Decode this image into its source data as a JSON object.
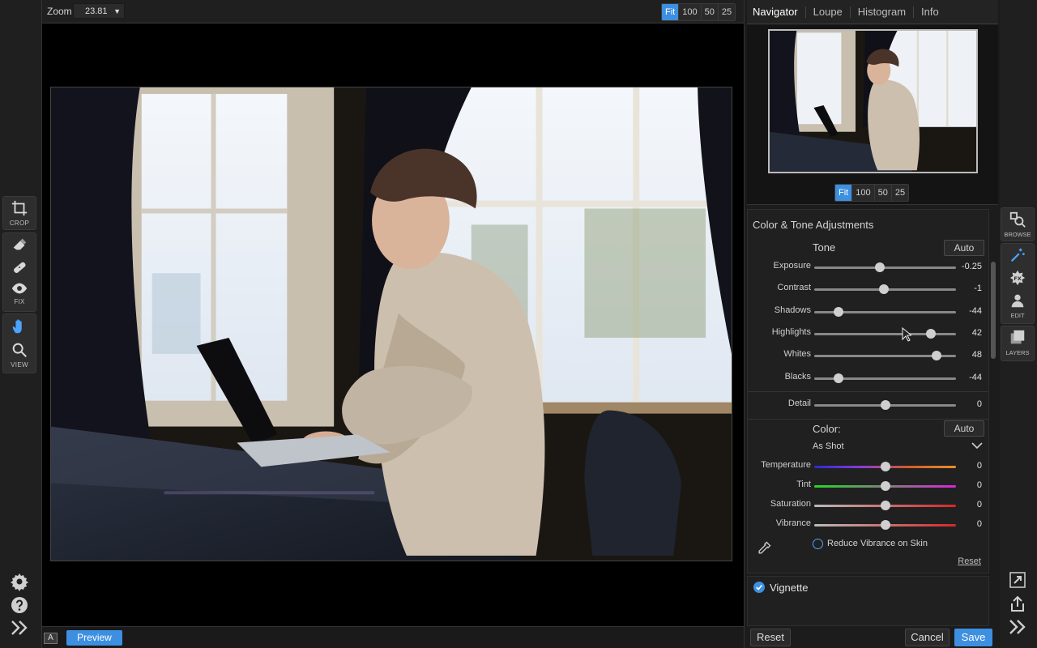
{
  "zoom": {
    "label": "Zoom",
    "value": "23.81",
    "presets": [
      "Fit",
      "100",
      "50",
      "25"
    ],
    "active": "Fit"
  },
  "left_tools": {
    "crop_label": "CROP",
    "fix_label": "FIX",
    "view_label": "VIEW"
  },
  "bottom": {
    "a_badge": "A",
    "preview": "Preview"
  },
  "tabs": [
    "Navigator",
    "Loupe",
    "Histogram",
    "Info"
  ],
  "navigator": {
    "presets": [
      "Fit",
      "100",
      "50",
      "25"
    ],
    "active": "Fit"
  },
  "adjustments": {
    "title": "Color & Tone Adjustments",
    "tone": {
      "title": "Tone",
      "auto": "Auto",
      "sliders": [
        {
          "label": "Exposure",
          "value": "-0.25",
          "pos": 0.46
        },
        {
          "label": "Contrast",
          "value": "-1",
          "pos": 0.49
        },
        {
          "label": "Shadows",
          "value": "-44",
          "pos": 0.17
        },
        {
          "label": "Highlights",
          "value": "42",
          "pos": 0.82
        },
        {
          "label": "Whites",
          "value": "48",
          "pos": 0.86
        },
        {
          "label": "Blacks",
          "value": "-44",
          "pos": 0.17
        }
      ]
    },
    "detail": {
      "label": "Detail",
      "value": "0",
      "pos": 0.5
    },
    "color": {
      "title": "Color:",
      "auto": "Auto",
      "preset": "As Shot",
      "sliders": [
        {
          "label": "Temperature",
          "value": "0",
          "pos": 0.5
        },
        {
          "label": "Tint",
          "value": "0",
          "pos": 0.5
        },
        {
          "label": "Saturation",
          "value": "0",
          "pos": 0.5
        },
        {
          "label": "Vibrance",
          "value": "0",
          "pos": 0.5
        }
      ],
      "reduce_vibrance": "Reduce Vibrance on Skin",
      "reset": "Reset"
    }
  },
  "vignette": {
    "label": "Vignette",
    "checked": true
  },
  "footer": {
    "reset": "Reset",
    "cancel": "Cancel",
    "save": "Save"
  },
  "right_tools": {
    "browse": "BROWSE",
    "edit": "EDIT",
    "layers": "LAYERS"
  },
  "colors": {
    "accent": "#3d8fe0",
    "panel": "#202020",
    "background": "#000000"
  }
}
